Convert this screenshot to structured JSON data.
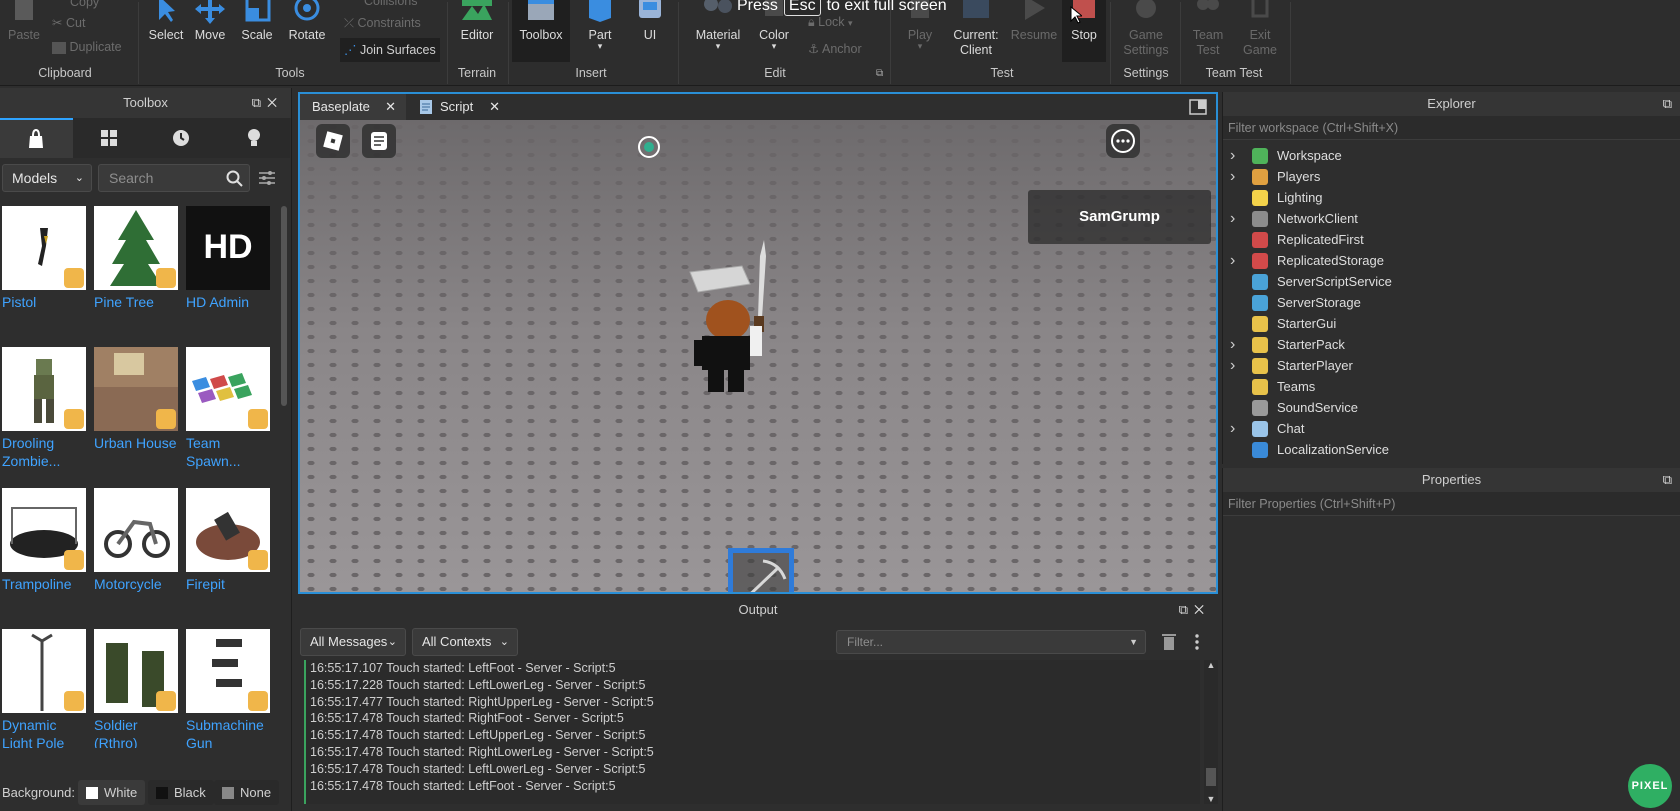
{
  "fullscreen_notice": {
    "press": "Press",
    "key": "Esc",
    "rest": "to exit full screen"
  },
  "ribbon": {
    "clipboard": {
      "paste": "Paste",
      "copy": "Copy",
      "cut": "Cut",
      "duplicate": "Duplicate",
      "group": "Clipboard"
    },
    "tools": {
      "select": "Select",
      "move": "Move",
      "scale": "Scale",
      "rotate": "Rotate",
      "collisions": "Collisions",
      "constraints": "Constraints",
      "join_surfaces": "Join Surfaces",
      "group": "Tools"
    },
    "terrain": {
      "editor": "Editor",
      "group": "Terrain"
    },
    "insert": {
      "toolbox": "Toolbox",
      "part": "Part",
      "ui": "UI",
      "group": "Insert"
    },
    "edit": {
      "material": "Material",
      "color": "Color",
      "lock": "Lock",
      "anchor": "Anchor",
      "group": "Edit"
    },
    "test": {
      "play": "Play",
      "current_client_1": "Current:",
      "current_client_2": "Client",
      "resume": "Resume",
      "stop": "Stop",
      "group": "Test"
    },
    "settings": {
      "game_1": "Game",
      "game_2": "Settings",
      "group": "Settings"
    },
    "team_test": {
      "team_1": "Team",
      "team_2": "Test",
      "exit_1": "Exit",
      "exit_2": "Game",
      "group": "Team Test"
    }
  },
  "toolbox": {
    "title": "Toolbox",
    "category": "Models",
    "search_placeholder": "Search",
    "items": [
      {
        "name": "Pistol"
      },
      {
        "name": "Pine Tree"
      },
      {
        "name": "HD Admin"
      },
      {
        "name": "Drooling Zombie..."
      },
      {
        "name": "Urban House"
      },
      {
        "name": "Team Spawn..."
      },
      {
        "name": "Trampoline"
      },
      {
        "name": "Motorcycle"
      },
      {
        "name": "Firepit"
      },
      {
        "name": "Dynamic Light Pole"
      },
      {
        "name": "Soldier (Rthro)"
      },
      {
        "name": "Submachine Gun"
      }
    ],
    "background_label": "Background:",
    "bg_white": "White",
    "bg_black": "Black",
    "bg_none": "None"
  },
  "viewport": {
    "tabs": [
      {
        "label": "Baseplate"
      },
      {
        "label": "Script"
      }
    ],
    "player_name": "SamGrump"
  },
  "output": {
    "title": "Output",
    "messages_filter": "All Messages",
    "contexts_filter": "All Contexts",
    "filter_placeholder": "Filter...",
    "lines": [
      {
        "time": "16:55:17.107",
        "text": "Touch started: LeftFoot",
        "source": "- Server - Script:5"
      },
      {
        "time": "16:55:17.228",
        "text": "Touch started: LeftLowerLeg",
        "source": "- Server - Script:5"
      },
      {
        "time": "16:55:17.477",
        "text": "Touch started: RightUpperLeg",
        "source": "- Server - Script:5"
      },
      {
        "time": "16:55:17.478",
        "text": "Touch started: RightFoot",
        "source": "- Server - Script:5"
      },
      {
        "time": "16:55:17.478",
        "text": "Touch started: LeftUpperLeg",
        "source": "- Server - Script:5"
      },
      {
        "time": "16:55:17.478",
        "text": "Touch started: RightLowerLeg",
        "source": "- Server - Script:5"
      },
      {
        "time": "16:55:17.478",
        "text": "Touch started: LeftLowerLeg",
        "source": "- Server - Script:5"
      },
      {
        "time": "16:55:17.478",
        "text": "Touch started: LeftFoot",
        "source": "- Server - Script:5"
      }
    ]
  },
  "explorer": {
    "title": "Explorer",
    "filter_placeholder": "Filter workspace (Ctrl+Shift+X)",
    "items": [
      {
        "label": "Workspace",
        "expandable": true,
        "icon_color": "#4fb35a"
      },
      {
        "label": "Players",
        "expandable": true,
        "icon_color": "#e0a040"
      },
      {
        "label": "Lighting",
        "expandable": false,
        "icon_color": "#f3d24a"
      },
      {
        "label": "NetworkClient",
        "expandable": true,
        "icon_color": "#8c8c8c"
      },
      {
        "label": "ReplicatedFirst",
        "expandable": false,
        "icon_color": "#d24a4a"
      },
      {
        "label": "ReplicatedStorage",
        "expandable": true,
        "icon_color": "#d24a4a"
      },
      {
        "label": "ServerScriptService",
        "expandable": false,
        "icon_color": "#4aa3d8"
      },
      {
        "label": "ServerStorage",
        "expandable": false,
        "icon_color": "#4aa3d8"
      },
      {
        "label": "StarterGui",
        "expandable": false,
        "icon_color": "#e8c24a"
      },
      {
        "label": "StarterPack",
        "expandable": true,
        "icon_color": "#e8c24a"
      },
      {
        "label": "StarterPlayer",
        "expandable": true,
        "icon_color": "#e8c24a"
      },
      {
        "label": "Teams",
        "expandable": false,
        "icon_color": "#e8c24a"
      },
      {
        "label": "SoundService",
        "expandable": false,
        "icon_color": "#9a9a9a"
      },
      {
        "label": "Chat",
        "expandable": true,
        "icon_color": "#9ac4e8"
      },
      {
        "label": "LocalizationService",
        "expandable": false,
        "icon_color": "#3a8ad8"
      }
    ]
  },
  "properties": {
    "title": "Properties",
    "filter_placeholder": "Filter Properties (Ctrl+Shift+P)"
  },
  "watermark": "PIXEL"
}
